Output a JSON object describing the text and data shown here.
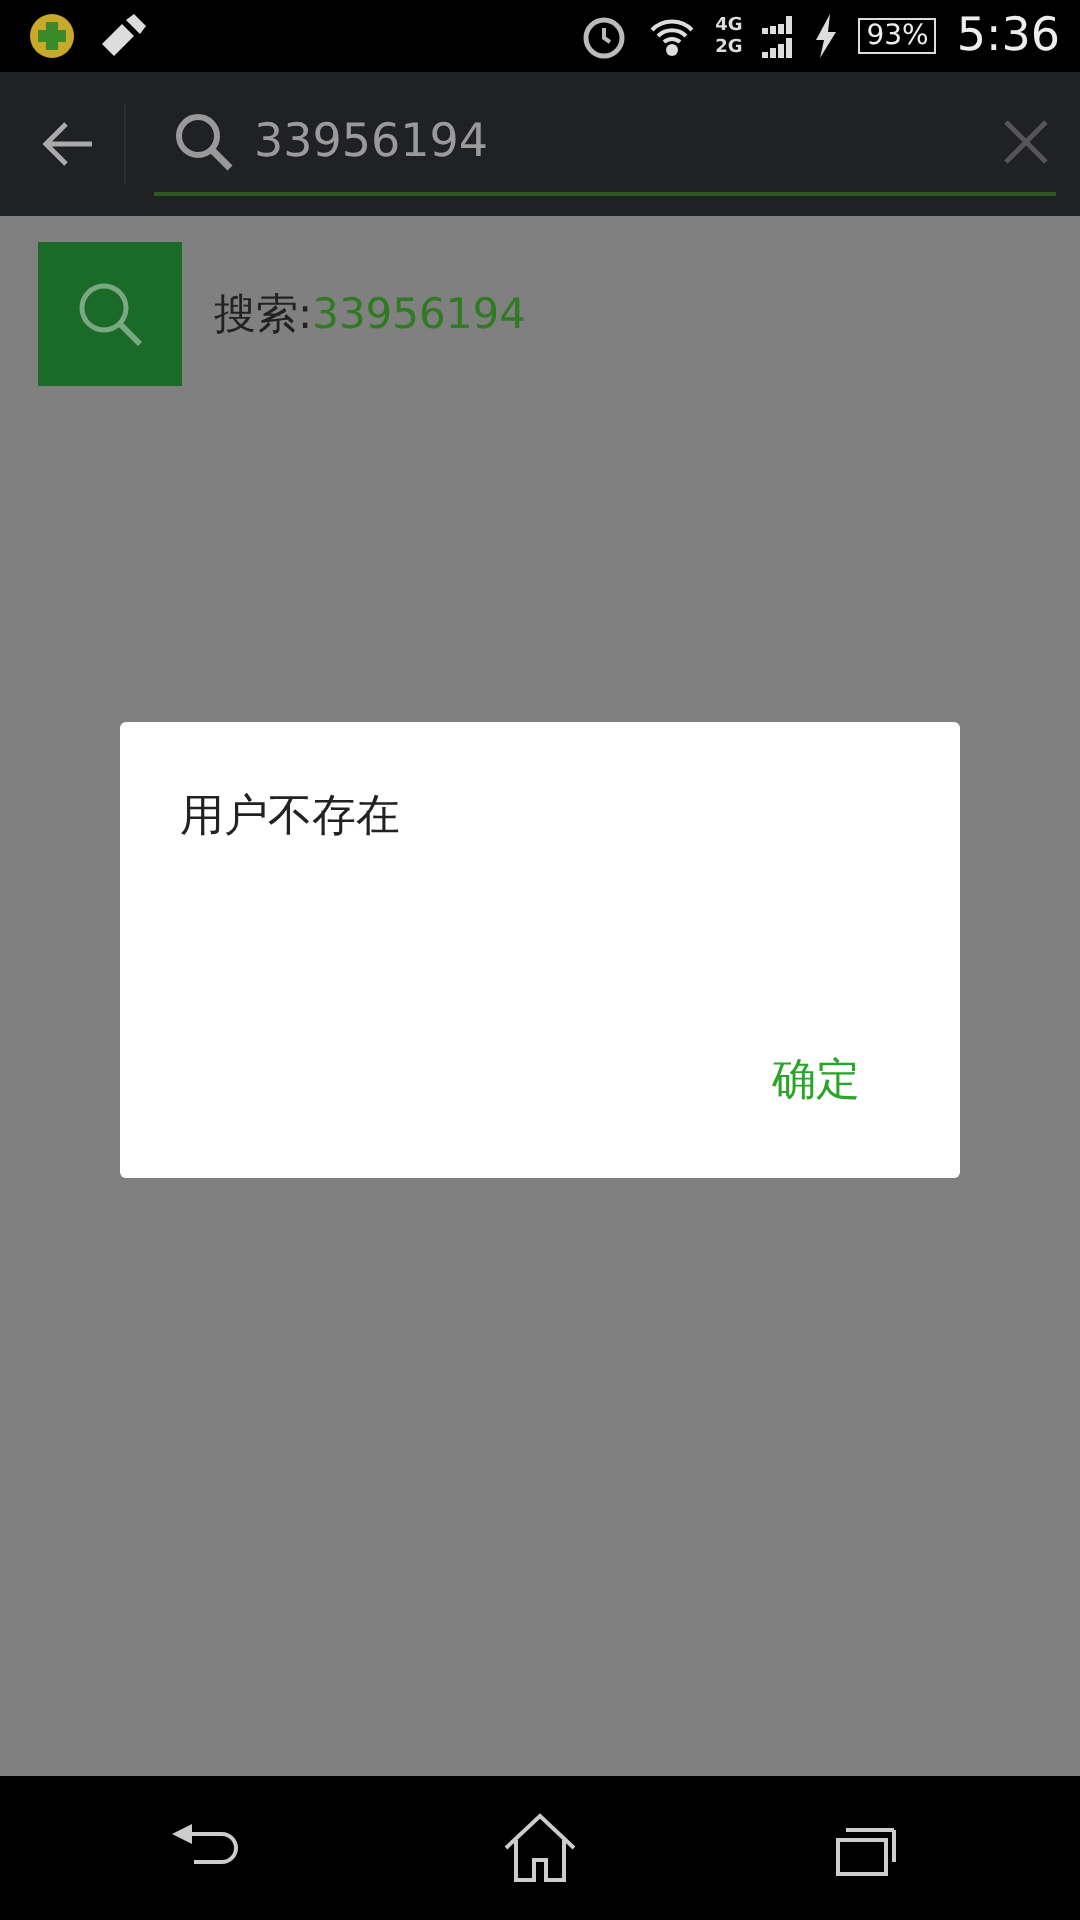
{
  "status_bar": {
    "network_labels": [
      "4G",
      "2G"
    ],
    "battery": "93%",
    "time": "5:36"
  },
  "search_bar": {
    "value": "33956194"
  },
  "result": {
    "label": "搜索:",
    "query": "33956194"
  },
  "dialog": {
    "message": "用户不存在",
    "button": "确定"
  }
}
